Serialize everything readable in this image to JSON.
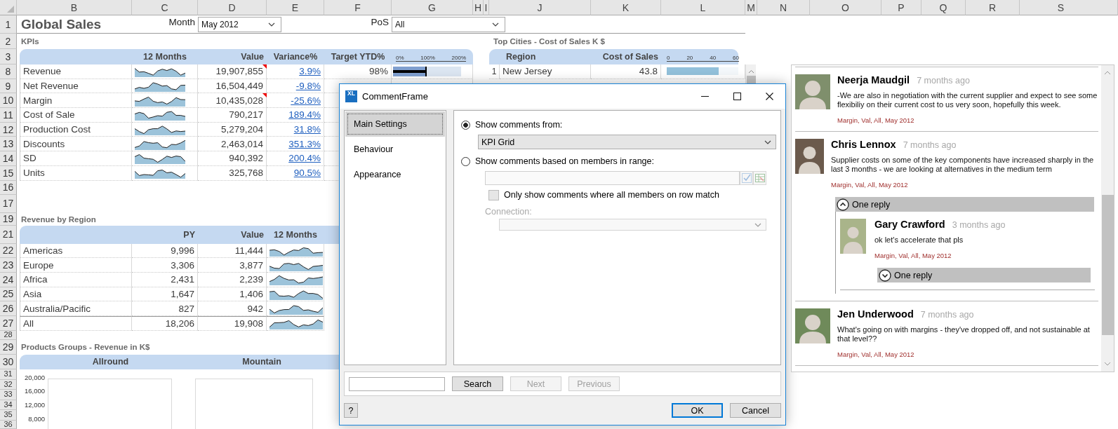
{
  "sheet": {
    "column_headers": [
      "B",
      "C",
      "D",
      "E",
      "F",
      "G",
      "H",
      "I",
      "J",
      "K",
      "L",
      "M",
      "N",
      "O",
      "P",
      "Q",
      "R",
      "S"
    ],
    "row_headers": [
      "1",
      "2",
      "3",
      "8",
      "9",
      "10",
      "11",
      "12",
      "13",
      "14",
      "15",
      "16",
      "17",
      "19",
      "21",
      "22",
      "23",
      "24",
      "25",
      "26",
      "27",
      "28",
      "29",
      "30",
      "31",
      "32",
      "33",
      "34",
      "35",
      "36"
    ],
    "title": "Global Sales",
    "filters": [
      {
        "label": "Month",
        "value": "May 2012"
      },
      {
        "label": "PoS",
        "value": "All"
      }
    ],
    "kpis": {
      "title": "KPIs",
      "columns": [
        "12 Months",
        "Value",
        "Variance%",
        "Target YTD%"
      ],
      "axis_ticks": [
        "0%",
        "100%",
        "200%"
      ],
      "rows": [
        {
          "name": "Revenue",
          "value": "19,907,855",
          "variance": "3.9%",
          "target": "98%",
          "level": 0.49,
          "has_comment": true
        },
        {
          "name": "Net Revenue",
          "value": "16,504,449",
          "variance": "-9.8%",
          "has_comment": false
        },
        {
          "name": "Margin",
          "value": "10,435,028",
          "variance": "-25.6%",
          "has_comment": true
        },
        {
          "name": "Cost of Sale",
          "value": "790,217",
          "variance": "189.4%",
          "has_comment": false
        },
        {
          "name": "Production Cost",
          "value": "5,279,204",
          "variance": "31.8%",
          "has_comment": false
        },
        {
          "name": "Discounts",
          "value": "2,463,014",
          "variance": "351.3%",
          "has_comment": false
        },
        {
          "name": "SD",
          "value": "940,392",
          "variance": "200.4%",
          "has_comment": false
        },
        {
          "name": "Units",
          "value": "325,768",
          "variance": "90.5%",
          "has_comment": false
        }
      ]
    },
    "top_cities": {
      "title": "Top Cities - Cost of Sales K $",
      "columns": [
        "Region",
        "Cost of Sales"
      ],
      "axis_ticks": [
        "0",
        "20",
        "40",
        "60"
      ],
      "rows": [
        {
          "rank": "1",
          "name": "New Jersey",
          "value": "43.8",
          "level": 0.73
        }
      ]
    },
    "revenue_by_region": {
      "title": "Revenue by Region",
      "columns": [
        "PY",
        "Value",
        "12 Months"
      ],
      "rows": [
        {
          "name": "Americas",
          "py": "9,996",
          "value": "11,444",
          "total": false
        },
        {
          "name": "Europe",
          "py": "3,306",
          "value": "3,877",
          "total": false
        },
        {
          "name": "Africa",
          "py": "2,431",
          "value": "2,239",
          "total": false
        },
        {
          "name": "Asia",
          "py": "1,647",
          "value": "1,406",
          "total": false
        },
        {
          "name": "Australia/Pacific",
          "py": "827",
          "value": "942",
          "total": false
        },
        {
          "name": "All",
          "py": "18,206",
          "value": "19,908",
          "total": true
        }
      ]
    },
    "product_groups": {
      "title": "Products Groups - Revenue in K$",
      "charts": [
        {
          "title": "Allround",
          "y_ticks": [
            "20,000",
            "16,000",
            "12,000",
            "8,000"
          ]
        },
        {
          "title": "Mountain"
        }
      ]
    }
  },
  "dialog": {
    "icon_text": "XL",
    "title": "CommentFrame",
    "nav": [
      {
        "label": "Main Settings",
        "selected": true
      },
      {
        "label": "Behaviour",
        "selected": false
      },
      {
        "label": "Appearance",
        "selected": false
      }
    ],
    "options": [
      {
        "kind": "radio",
        "label": "Show comments from:",
        "checked": true,
        "children": [
          {
            "kind": "dropdown",
            "value": "KPI Grid",
            "disabled": false
          }
        ]
      },
      {
        "kind": "radio",
        "label": "Show comments based on members in range:",
        "checked": false,
        "children": [
          {
            "kind": "range",
            "disabled": true
          },
          {
            "kind": "checkbox",
            "label": "Only show comments where all members on row match",
            "checked": false,
            "disabled": true
          },
          {
            "kind": "labeled_dropdown",
            "label": "Connection:",
            "disabled": true
          }
        ]
      }
    ],
    "search_buttons": [
      {
        "label": "Search",
        "disabled": false
      },
      {
        "label": "Next",
        "disabled": true
      },
      {
        "label": "Previous",
        "disabled": true
      }
    ],
    "help": "?",
    "buttons": [
      {
        "label": "OK",
        "default": true
      },
      {
        "label": "Cancel",
        "default": false
      }
    ]
  },
  "comments": [
    {
      "author": "Neerja Maudgil",
      "time": "7 months ago",
      "text": "-We are also in negotiation with the current supplier and expect to see some flexibiliy on their current cost to us very soon, hopefully this week.",
      "tags": "Margin, Val, All, May 2012"
    },
    {
      "author": "Chris Lennox",
      "time": "7 months ago",
      "text": "Supplier costs on some of the key components have increased sharply in the last 3 months - we are looking at alternatives in the medium term",
      "tags": "Margin, Val, All, May 2012",
      "replies_toggle": {
        "label": "One reply",
        "expanded": true
      },
      "replies": [
        {
          "author": "Gary Crawford",
          "time": "3 months ago",
          "text": "ok let's accelerate that pls",
          "tags": "Margin, Val, All, May 2012",
          "replies_toggle": {
            "label": "One reply",
            "expanded": false
          }
        }
      ]
    },
    {
      "author": "Jen Underwood",
      "time": "7 months ago",
      "text": "What's going on with margins - they've dropped off, and not sustainable at that level??",
      "tags": "Margin, Val, All, May 2012"
    }
  ]
}
